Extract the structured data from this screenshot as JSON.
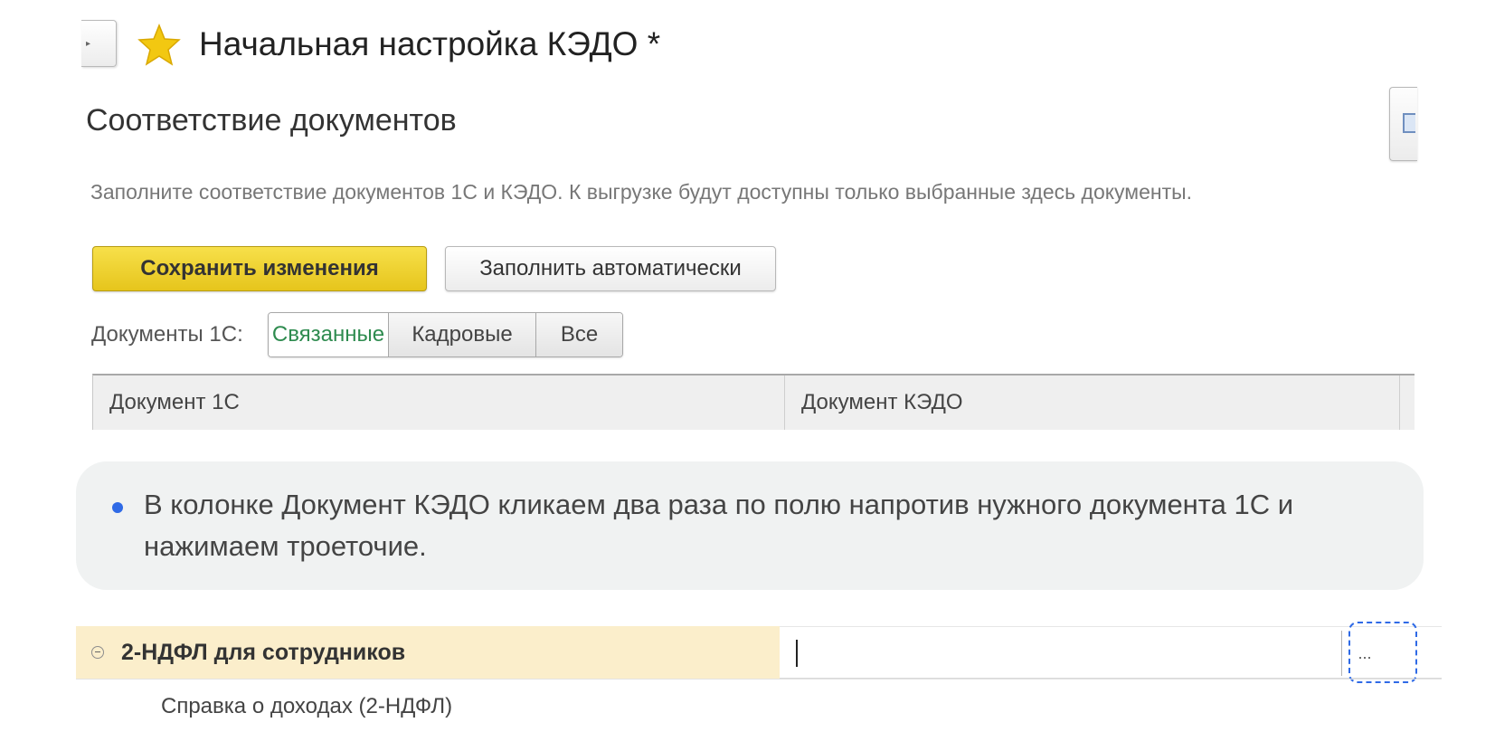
{
  "window": {
    "title": "Начальная настройка КЭДО *",
    "star_icon": "star-icon"
  },
  "section": {
    "title": "Соответствие документов",
    "hint": "Заполните соответствие документов 1С и КЭДО. К выгрузке будут доступны только выбранные здесь документы."
  },
  "toolbar": {
    "save_label": "Сохранить изменения",
    "fill_label": "Заполнить автоматически"
  },
  "filter": {
    "label": "Документы 1С:",
    "options": [
      "Связанные",
      "Кадровые",
      "Все"
    ],
    "selected": "Связанные"
  },
  "table": {
    "columns": [
      "Документ 1С",
      "Документ КЭДО"
    ]
  },
  "callout": {
    "text": "В колонке Документ КЭДО кликаем два раза по полю напротив нужного документа 1С и нажимаем троеточие."
  },
  "grid": {
    "group_label": "2-НДФЛ для сотрудников",
    "choice_button_label": "...",
    "sub_item": "Справка о доходах (2-НДФЛ)"
  },
  "colors": {
    "accent_yellow": "#e6c51c",
    "highlight_blue": "#2f6ae6",
    "active_filter_green": "#2e8b4f",
    "group_row_bg": "#fbeecb"
  }
}
